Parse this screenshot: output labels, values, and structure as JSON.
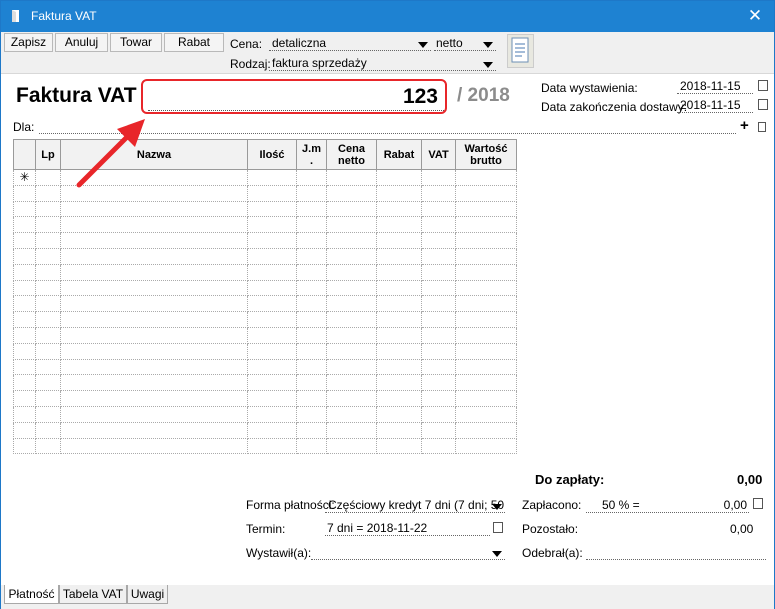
{
  "window": {
    "title": "Faktura VAT",
    "close": "✕"
  },
  "toolbar": {
    "save": "Zapisz",
    "cancel": "Anuluj",
    "goods": "Towar",
    "discount": "Rabat",
    "price_label": "Cena:",
    "price_value": "detaliczna",
    "price_basis": "netto",
    "type_label": "Rodzaj:",
    "type_value": "faktura sprzedaży"
  },
  "header": {
    "title": "Faktura VAT",
    "number": "123",
    "year": "/ 2018",
    "issue_label": "Data wystawienia:",
    "issue_date": "2018-11-15",
    "delivery_label": "Data zakończenia dostawy:",
    "delivery_date": "2018-11-15",
    "recipient_label": "Dla:",
    "add": "+"
  },
  "table": {
    "columns": [
      "",
      "Lp",
      "Nazwa",
      "Ilość",
      "J.m .",
      "Cena netto",
      "Rabat",
      "VAT",
      "Wartość brutto"
    ],
    "new_row_marker": "✳"
  },
  "summary": {
    "to_pay_label": "Do zapłaty:",
    "to_pay_value": "0,00",
    "payment_form_label": "Forma płatności:",
    "payment_form_value": "Częściowy kredyt 7 dni (7 dni; 50",
    "paid_label": "Zapłacono:",
    "paid_percent": "50 % =",
    "paid_value": "0,00",
    "term_label": "Termin:",
    "term_value": "7 dni = 2018-11-22",
    "remaining_label": "Pozostało:",
    "remaining_value": "0,00",
    "issued_by_label": "Wystawił(a):",
    "received_by_label": "Odebrał(a):"
  },
  "tabs": [
    "Płatność",
    "Tabela VAT",
    "Uwagi"
  ],
  "colors": {
    "titlebar": "#1e82d2",
    "highlight": "#e8262a",
    "year": "#8c8c8c"
  }
}
